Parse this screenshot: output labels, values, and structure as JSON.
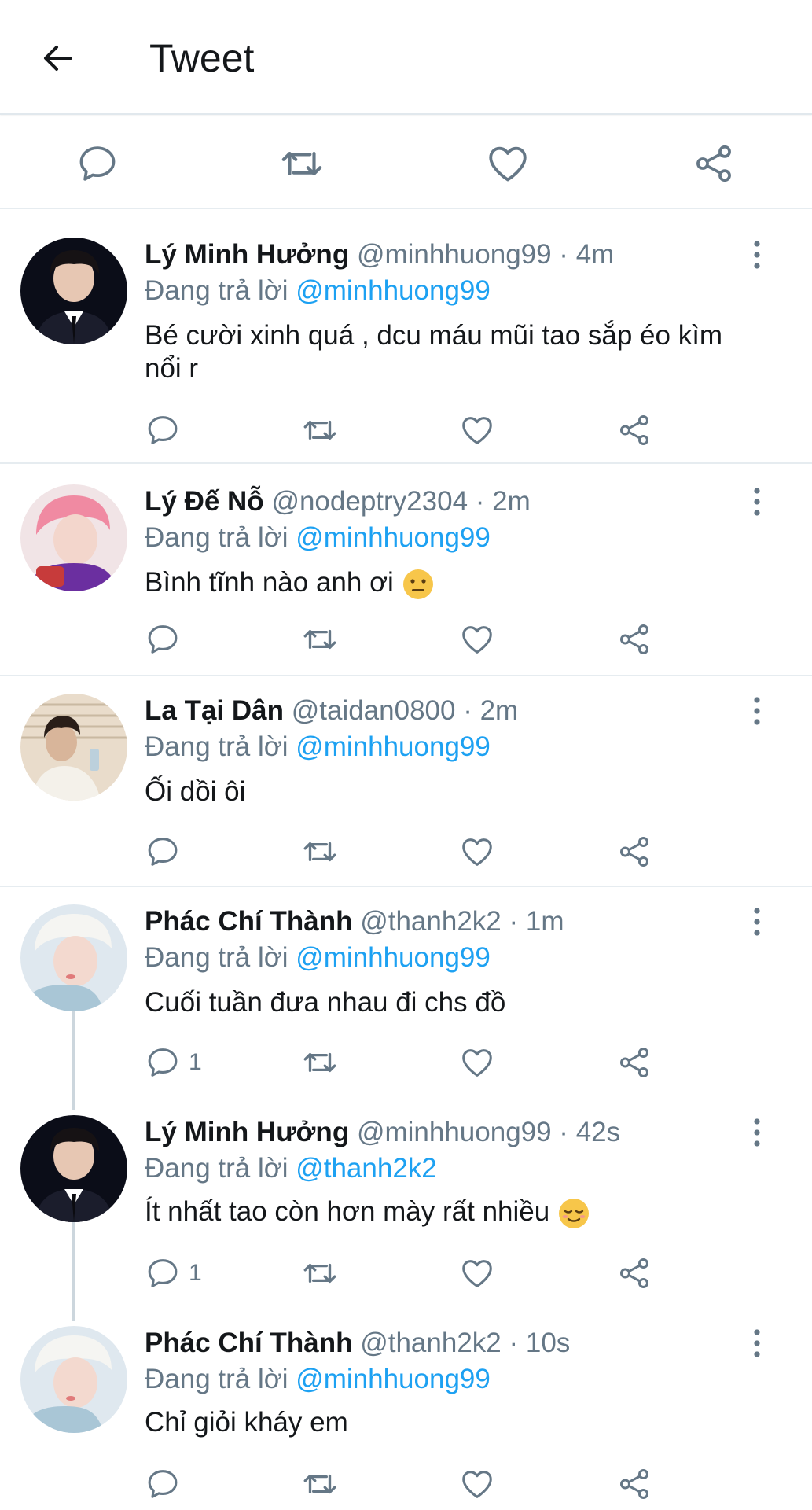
{
  "header": {
    "title": "Tweet",
    "back_icon": "arrow-left-icon"
  },
  "colors": {
    "link": "#1da1f2",
    "muted": "#657786",
    "icon": "#657786",
    "divider": "#e6ecf0"
  },
  "replies": [
    {
      "name": "Lý Minh Hưởng",
      "handle": "@minhhuong99 · 4m",
      "reply_prefix": "Đang trả lời",
      "reply_to": "@minhhuong99",
      "text_line1": "Bé cười xinh quá , dcu máu mũi tao sắp éo kìm",
      "text_line2": "nổi r",
      "reply_count": ""
    },
    {
      "name": "Lý Đế Nỗ",
      "handle": "@nodeptry2304 · 2m",
      "reply_prefix": "Đang trả lời",
      "reply_to": "@minhhuong99",
      "text": "Bình tĩnh nào anh ơi",
      "emoji": "neutral-face-icon",
      "reply_count": ""
    },
    {
      "name": "La Tại Dân",
      "handle": "@taidan0800 · 2m",
      "reply_prefix": "Đang trả lời",
      "reply_to": "@minhhuong99",
      "text": "Ối dồi ôi",
      "reply_count": ""
    },
    {
      "name": "Phác Chí Thành",
      "handle": "@thanh2k2 · 1m",
      "reply_prefix": "Đang trả lời",
      "reply_to": "@minhhuong99",
      "text": "Cuối tuần đưa nhau đi chs đồ",
      "reply_count": "1"
    },
    {
      "name": "Lý Minh Hưởng",
      "handle": "@minhhuong99 · 42s",
      "reply_prefix": "Đang trả lời",
      "reply_to": "@thanh2k2",
      "text": "Ít nhất tao còn hơn mày rất nhiều",
      "emoji": "relieved-face-icon",
      "reply_count": "1"
    },
    {
      "name": "Phác Chí Thành",
      "handle": "@thanh2k2 · 10s",
      "reply_prefix": "Đang trả lời",
      "reply_to": "@minhhuong99",
      "text": "Chỉ giỏi kháy em",
      "reply_count": ""
    }
  ]
}
